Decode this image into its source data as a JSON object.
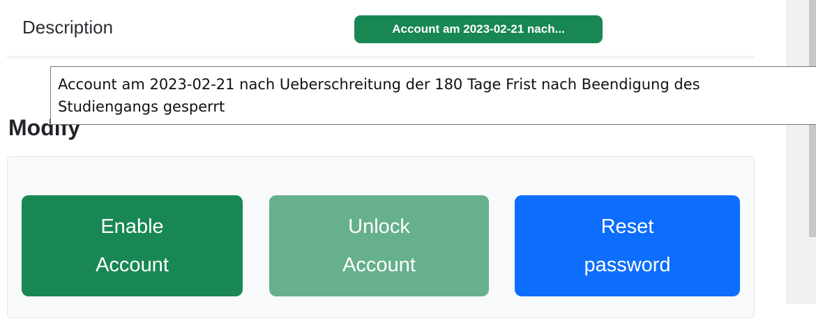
{
  "description": {
    "label": "Description",
    "badge_text": "Account am 2023-02-21 nach..."
  },
  "tooltip": {
    "line1": "Account am 2023-02-21 nach Ueberschreitung der 180 Tage Frist nach Beendigung des",
    "line2": "Studiengangs gesperrt"
  },
  "modify": {
    "title": "Modify",
    "buttons": {
      "enable": {
        "line1": "Enable",
        "line2": "Account"
      },
      "unlock": {
        "line1": "Unlock",
        "line2": "Account"
      },
      "reset": {
        "line1": "Reset",
        "line2": "password"
      }
    }
  },
  "colors": {
    "success": "#198754",
    "success_disabled": "#66b08d",
    "primary": "#0d6efd"
  }
}
